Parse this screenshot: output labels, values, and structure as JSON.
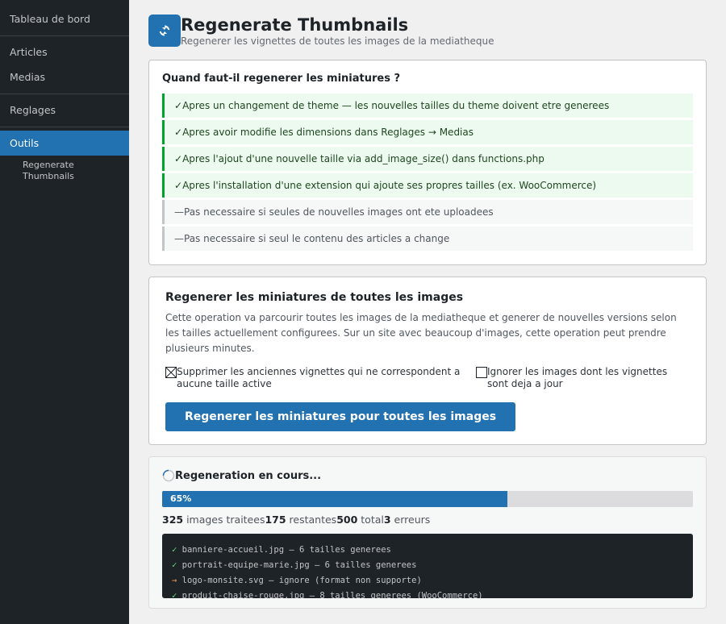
{
  "sidebar": {
    "items": [
      {
        "label": "Tableau de bord"
      },
      {
        "label": "Articles"
      },
      {
        "label": "Medias"
      },
      {
        "label": "Reglages"
      },
      {
        "label": "Outils"
      }
    ],
    "subitem": "Regenerate Thumbnails"
  },
  "header": {
    "title": "Regenerate Thumbnails",
    "subtitle": "Regenerer les vignettes de toutes les images de la mediatheque",
    "icon": "refresh-icon"
  },
  "when": {
    "title": "Quand faut-il regenerer les miniatures ?",
    "items": [
      {
        "mark": "✓",
        "text": "Apres un changement de theme — les nouvelles tailles du theme doivent etre generees"
      },
      {
        "mark": "✓",
        "text": "Apres avoir modifie les dimensions dans Reglages → Medias"
      },
      {
        "mark": "✓",
        "text": "Apres l'ajout d'une nouvelle taille via add_image_size() dans functions.php"
      },
      {
        "mark": "✓",
        "text": "Apres l'installation d'une extension qui ajoute ses propres tailles (ex. WooCommerce)"
      },
      {
        "mark": "—",
        "text": "Pas necessaire si seules de nouvelles images ont ete uploadees"
      },
      {
        "mark": "—",
        "text": "Pas necessaire si seul le contenu des articles a change"
      }
    ]
  },
  "regen": {
    "title": "Regenerer les miniatures de toutes les images",
    "description": "Cette operation va parcourir toutes les images de la mediatheque et generer de nouvelles versions selon les tailles actuellement configurees. Sur un site avec beaucoup d'images, cette operation peut prendre plusieurs minutes.",
    "option1": {
      "label": "Supprimer les anciennes vignettes qui ne correspondent a aucune taille active",
      "checked": true
    },
    "option2": {
      "label": "Ignorer les images dont les vignettes sont deja a jour",
      "checked": false
    },
    "button_label": "Regenerer les miniatures pour toutes les images"
  },
  "progress": {
    "title": "Regeneration en cours...",
    "percent": 65,
    "percent_label": "65%",
    "processed": "325",
    "processed_label": " images traitees",
    "remaining": "175",
    "remaining_label": " restantes",
    "total": "500",
    "total_label": " total",
    "errors": "3",
    "errors_label": " erreurs",
    "log": [
      {
        "mark": "✓",
        "text": " banniere-accueil.jpg — 6 tailles generees",
        "status": "ok"
      },
      {
        "mark": "✓",
        "text": " portrait-equipe-marie.jpg — 6 tailles generees",
        "status": "ok"
      },
      {
        "mark": "→",
        "text": " logo-monsite.svg — ignore (format non supporte)",
        "status": "warn"
      },
      {
        "mark": "✓",
        "text": " produit-chaise-rouge.jpg — 8 tailles generees (WooCommerce)",
        "status": "ok"
      }
    ]
  },
  "colors": {
    "accent": "#2271b1",
    "sidebar": "#1d2327",
    "success": "#00a32a"
  }
}
